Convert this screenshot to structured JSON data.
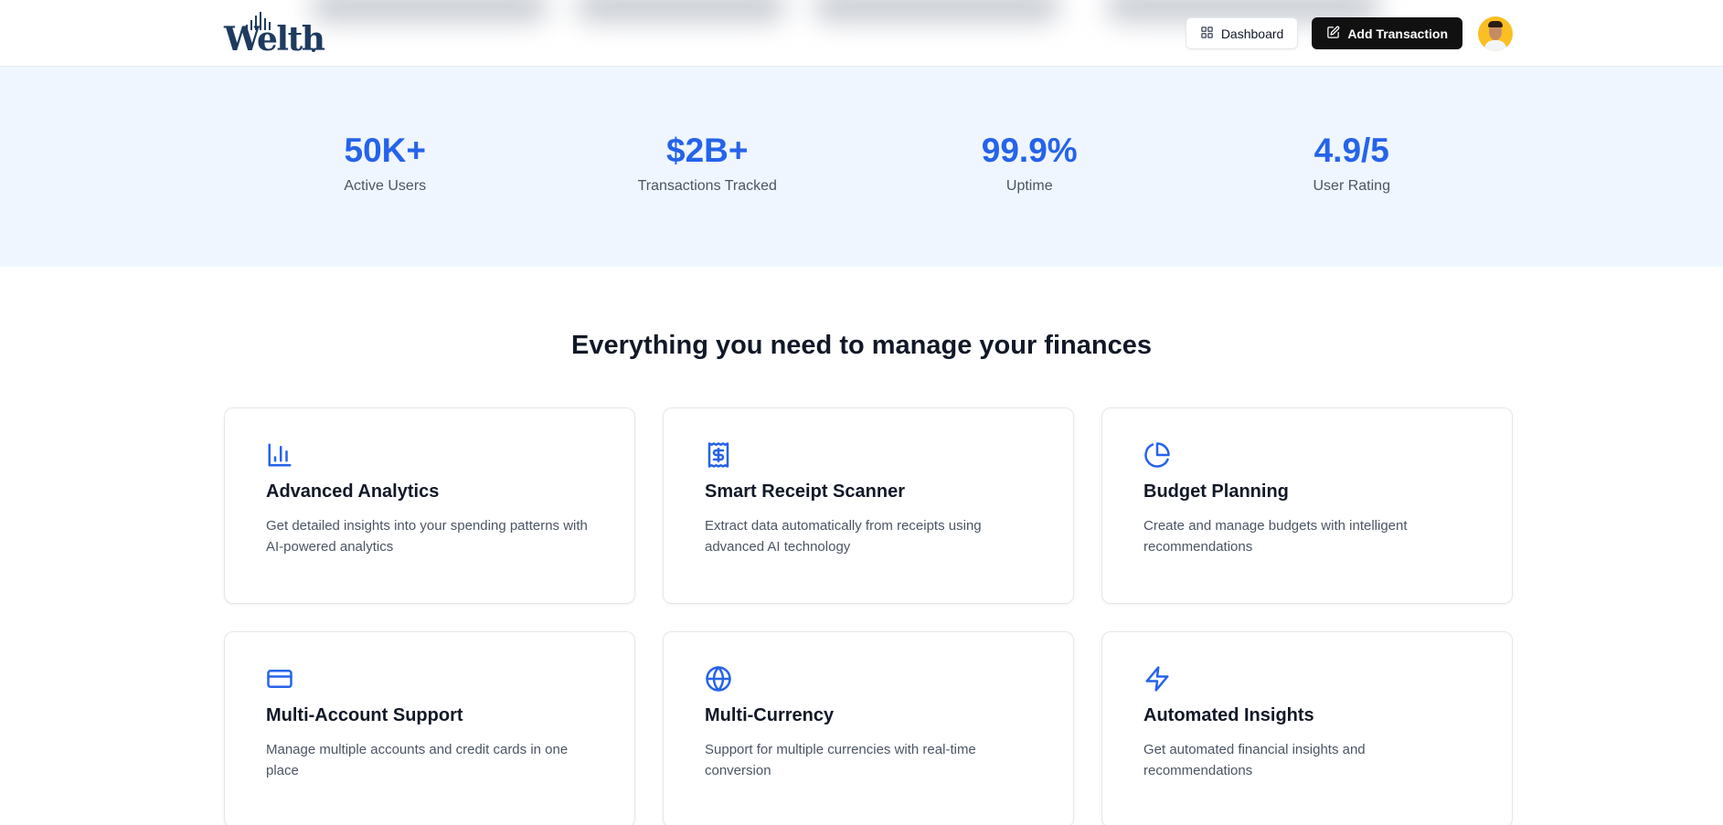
{
  "header": {
    "logo_text": "Welth",
    "dashboard_label": "Dashboard",
    "add_transaction_label": "Add Transaction",
    "avatar_icon": "user-avatar"
  },
  "stats": [
    {
      "value": "50K+",
      "label": "Active Users"
    },
    {
      "value": "$2B+",
      "label": "Transactions Tracked"
    },
    {
      "value": "99.9%",
      "label": "Uptime"
    },
    {
      "value": "4.9/5",
      "label": "User Rating"
    }
  ],
  "features": {
    "title": "Everything you need to manage your finances",
    "items": [
      {
        "icon": "bar-chart-icon",
        "title": "Advanced Analytics",
        "description": "Get detailed insights into your spending patterns with AI-powered analytics"
      },
      {
        "icon": "receipt-icon",
        "title": "Smart Receipt Scanner",
        "description": "Extract data automatically from receipts using advanced AI technology"
      },
      {
        "icon": "pie-chart-icon",
        "title": "Budget Planning",
        "description": "Create and manage budgets with intelligent recommendations"
      },
      {
        "icon": "credit-card-icon",
        "title": "Multi-Account Support",
        "description": "Manage multiple accounts and credit cards in one place"
      },
      {
        "icon": "globe-icon",
        "title": "Multi-Currency",
        "description": "Support for multiple currencies with real-time conversion"
      },
      {
        "icon": "zap-icon",
        "title": "Automated Insights",
        "description": "Get automated financial insights and recommendations"
      }
    ]
  },
  "colors": {
    "accent": "#2563eb",
    "band_background": "#eff6ff",
    "dark_button": "#111111",
    "logo": "#1e3a5f"
  }
}
